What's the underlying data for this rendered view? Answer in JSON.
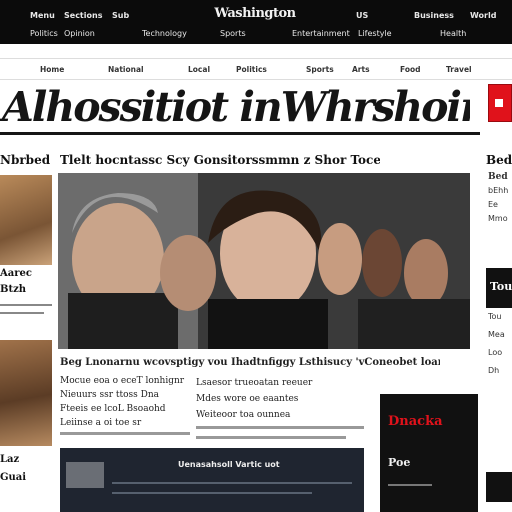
{
  "top_nav": {
    "items": [
      "Menu",
      "Sections",
      "Sub",
      "US",
      "Business",
      "World"
    ],
    "brand": "Washington",
    "row2": [
      "Politics",
      "Opinion",
      "Technology",
      "Sports",
      "Entertainment",
      "Lifestyle",
      "Health"
    ]
  },
  "subnav": {
    "items": [
      "Home",
      "National",
      "Local",
      "Politics",
      "Sports",
      "Arts",
      "Food",
      "Travel"
    ]
  },
  "masthead": {
    "title": "Alhossitiot inWhrshoing"
  },
  "section_headers": {
    "left": "Nbrbed",
    "center": "Tlelt hocntassc Scy Gonsitorssmmn z Shor Tocerh",
    "right": "Bede"
  },
  "left_col": {
    "story1": [
      "Aarec",
      "Btzh"
    ],
    "story2": [
      "Laz",
      "Guai"
    ]
  },
  "hero": {
    "caption": "Beg Lnonarnu wcovsptigy vou Ihadtnfiggy Lsthisucy 'vConeobet loanes'"
  },
  "article_text": {
    "col1": [
      "Mocue eoa o eceT lonhignr",
      "Nieuurs ssr ttoss Dna",
      "Fteeis ee lcoL Bsoaohd",
      "Leiinse a oi toe sr"
    ],
    "col2": [
      "Lsaesor trueoatan reeuer",
      "Mdes wore oe eaantes",
      "Weiteoor toa ounnea"
    ]
  },
  "video": {
    "label": "Uenasahsoll Vartic uot"
  },
  "promo": {
    "title": "Dnacka",
    "sub": "Poe"
  },
  "right_col": {
    "items": [
      "Bed",
      "bEhh",
      "Ee",
      "Mmo",
      "Tou",
      "Mea",
      "Loo",
      "Dh"
    ],
    "box_label": "Tou"
  },
  "colors": {
    "accent": "#e0121b",
    "dark": "#0b0b0b"
  }
}
